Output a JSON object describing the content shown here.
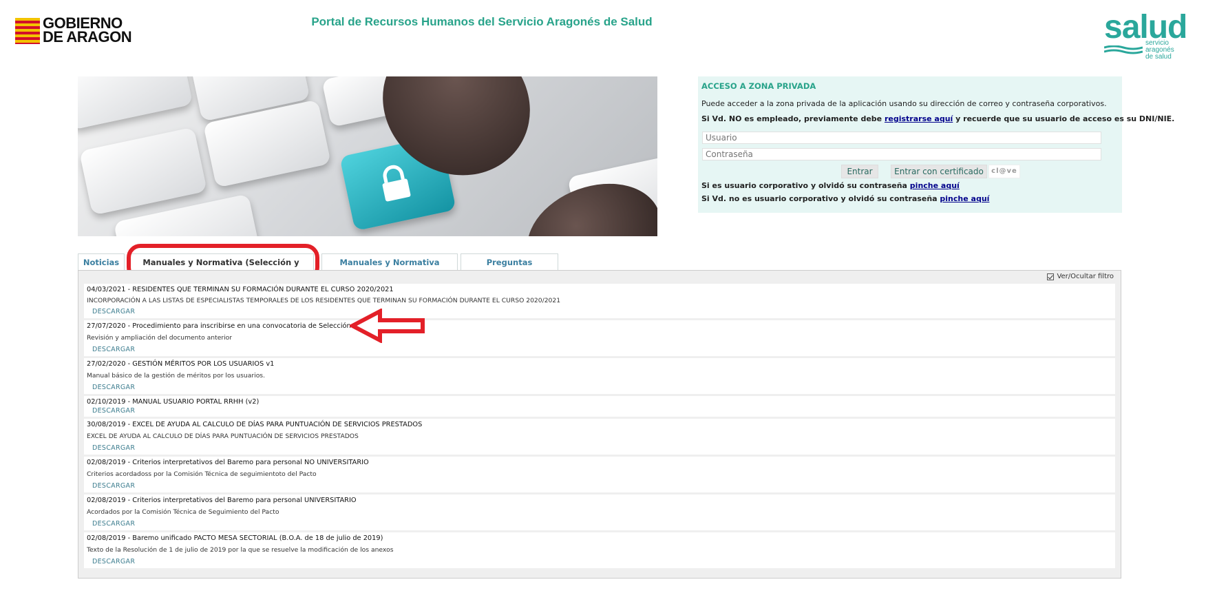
{
  "header": {
    "gov_logo_line1": "GOBIERNO",
    "gov_logo_line2": "DE ARAGON",
    "portal_title": "Portal de Recursos Humanos del Servicio Aragonés de Salud",
    "salud_word": "salud",
    "salud_sub1": "servicio aragonés",
    "salud_sub2": "de salud"
  },
  "access": {
    "title": "ACCESO A ZONA PRIVADA",
    "intro": "Puede acceder a la zona privada de la aplicación usando su dirección de correo y contraseña corporativos.",
    "not_employee_pre": "Si Vd. NO es empleado, previamente debe ",
    "not_employee_link": "registrarse aquí",
    "not_employee_post": " y recuerde que su usuario de acceso es su DNI/NIE.",
    "user_placeholder": "Usuario",
    "password_placeholder": "Contraseña",
    "enter_label": "Entrar",
    "cert_label": "Entrar con certificado",
    "clave_label": "cl@ve",
    "forgot_corp_pre": "Si es usuario corporativo y olvidó su contraseña ",
    "forgot_corp_link": "pinche aquí",
    "forgot_noncorp_pre": "Si Vd. no es usuario corporativo y olvidó su contraseña ",
    "forgot_noncorp_link": "pinche aquí"
  },
  "tabs": [
    {
      "label": "Noticias"
    },
    {
      "label": "Manuales y Normativa (Selección y provisión)"
    },
    {
      "label": "Manuales y Normativa (Carrera)"
    },
    {
      "label": "Preguntas Frecuentes"
    }
  ],
  "filter_toggle": "Ver/Ocultar filtro",
  "documents": [
    {
      "title": "04/03/2021 - RESIDENTES QUE TERMINAN SU FORMACIÓN DURANTE EL CURSO 2020/2021",
      "desc": "INCORPORACIÓN A LAS LISTAS DE ESPECIALISTAS TEMPORALES DE LOS RESIDENTES QUE TERMINAN SU FORMACIÓN DURANTE EL CURSO 2020/2021",
      "download": "DESCARGAR"
    },
    {
      "title": "27/07/2020 - Procedimiento para inscribirse en una convocatoria de Selección V2",
      "desc": "Revisión y ampliación del documento anterior",
      "download": "DESCARGAR"
    },
    {
      "title": "27/02/2020 - GESTIÓN MÉRITOS POR LOS USUARIOS v1",
      "desc": "Manual básico de la gestión de méritos por los usuarios.",
      "download": "DESCARGAR"
    },
    {
      "title": "02/10/2019 - MANUAL USUARIO PORTAL RRHH (v2)",
      "desc": "",
      "download": "DESCARGAR"
    },
    {
      "title": "30/08/2019 - EXCEL DE AYUDA AL CALCULO DE DÍAS PARA PUNTUACIÓN DE SERVICIOS PRESTADOS",
      "desc": "EXCEL DE AYUDA AL CALCULO DE DÍAS PARA PUNTUACIÓN DE SERVICIOS PRESTADOS",
      "download": "DESCARGAR"
    },
    {
      "title": "02/08/2019 - Criterios interpretativos del Baremo para personal NO UNIVERSITARIO",
      "desc": "Criterios acordadoss por la Comisión Técnica de seguimientoto del Pacto",
      "download": "DESCARGAR"
    },
    {
      "title": "02/08/2019 - Criterios interpretativos del Baremo para personal UNIVERSITARIO",
      "desc": "Acordados por la Comisión Técnica de Seguimiento del Pacto",
      "download": "DESCARGAR"
    },
    {
      "title": "02/08/2019 - Baremo unificado PACTO MESA SECTORIAL (B.O.A. de 18 de julio de 2019)",
      "desc": "Texto de la Resolución de 1 de julio de 2019 por la que se resuelve la modificación de los anexos",
      "download": "DESCARGAR"
    }
  ],
  "colors": {
    "brand_teal": "#28a38a",
    "highlight_red": "#e32028",
    "link_blue": "#00008b"
  }
}
